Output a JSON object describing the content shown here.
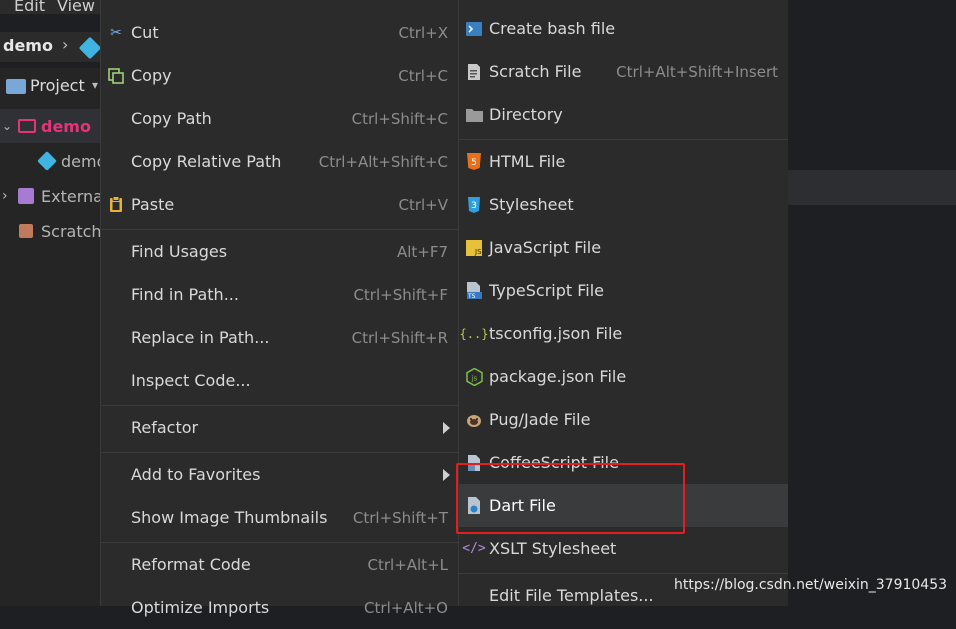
{
  "menubar": {
    "edit": "Edit",
    "view": "View"
  },
  "breadcrumb": {
    "project": "demo"
  },
  "project_panel": {
    "title": "Project"
  },
  "tree": [
    {
      "label": "demo"
    },
    {
      "label": "demo"
    },
    {
      "label": "External"
    },
    {
      "label": "Scratch"
    }
  ],
  "context_menu": {
    "cut": {
      "label": "Cut",
      "shortcut": "Ctrl+X"
    },
    "copy": {
      "label": "Copy",
      "shortcut": "Ctrl+C"
    },
    "copy_path": {
      "label": "Copy Path",
      "shortcut": "Ctrl+Shift+C"
    },
    "copy_relative_path": {
      "label": "Copy Relative Path",
      "shortcut": "Ctrl+Alt+Shift+C"
    },
    "paste": {
      "label": "Paste",
      "shortcut": "Ctrl+V"
    },
    "find_usages": {
      "label": "Find Usages",
      "shortcut": "Alt+F7"
    },
    "find_in_path": {
      "label": "Find in Path...",
      "shortcut": "Ctrl+Shift+F"
    },
    "replace_in_path": {
      "label": "Replace in Path...",
      "shortcut": "Ctrl+Shift+R"
    },
    "inspect_code": {
      "label": "Inspect Code..."
    },
    "refactor": {
      "label": "Refactor"
    },
    "add_to_favorites": {
      "label": "Add to Favorites"
    },
    "show_image_thumbnails": {
      "label": "Show Image Thumbnails",
      "shortcut": "Ctrl+Shift+T"
    },
    "reformat_code": {
      "label": "Reformat Code",
      "shortcut": "Ctrl+Alt+L"
    },
    "optimize_imports": {
      "label": "Optimize Imports",
      "shortcut": "Ctrl+Alt+O"
    }
  },
  "new_submenu": {
    "bash": {
      "label": "Create bash file"
    },
    "scratch": {
      "label": "Scratch File",
      "shortcut": "Ctrl+Alt+Shift+Insert"
    },
    "directory": {
      "label": "Directory"
    },
    "html": {
      "label": "HTML File"
    },
    "stylesheet": {
      "label": "Stylesheet"
    },
    "javascript": {
      "label": "JavaScript File"
    },
    "typescript": {
      "label": "TypeScript File"
    },
    "tsconfig": {
      "label": "tsconfig.json File"
    },
    "package_json": {
      "label": "package.json File"
    },
    "pug": {
      "label": "Pug/Jade File"
    },
    "coffee": {
      "label": "CoffeeScript File"
    },
    "dart": {
      "label": "Dart File"
    },
    "xslt": {
      "label": "XSLT Stylesheet"
    },
    "edit_templates": {
      "label": "Edit File Templates..."
    }
  },
  "watermark": "https://blog.csdn.net/weixin_37910453",
  "colors": {
    "highlight_box": "#e02020",
    "menu_bg": "#2b2b2b",
    "project_name": "#e5347a"
  }
}
